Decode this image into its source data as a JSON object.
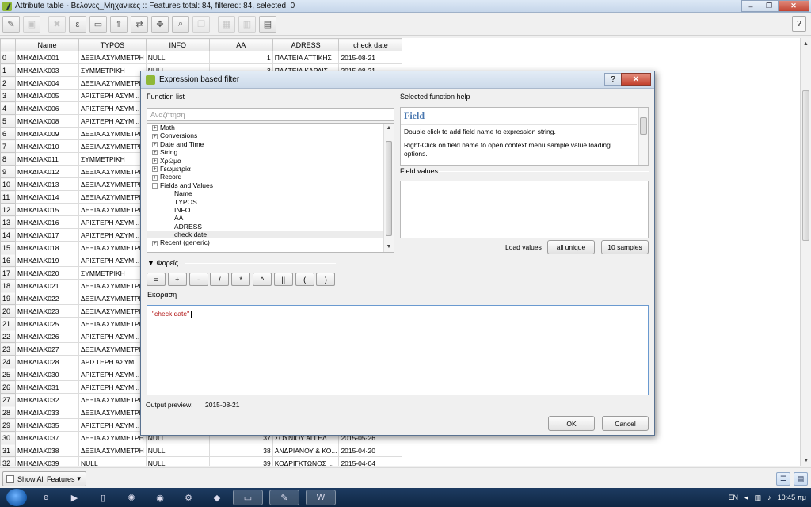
{
  "window": {
    "title": "Attribute table - Βελόνες_Μηχανικές :: Features total: 84, filtered: 84, selected: 0",
    "controls": [
      "–",
      "❐",
      "✕"
    ]
  },
  "toolbar": {
    "help": "?"
  },
  "table": {
    "columns": [
      "Name",
      "TYPOS",
      "INFO",
      "AA",
      "ADRESS",
      "check date"
    ],
    "rows": [
      [
        "0",
        "ΜΗΧΔΙΑΚ001",
        "ΔΕΞΙΑ ΑΣΥΜΜΕΤΡΗ",
        "NULL",
        "1",
        "ΠΛΑΤΕΙΑ ΑΤΤΙΚΗΣ",
        "2015-08-21"
      ],
      [
        "1",
        "ΜΗΧΔΙΑΚ003",
        "ΣΥΜΜΕΤΡΙΚΗ",
        "NULL",
        "3",
        "ΠΛΑΤΕΙΑ ΚΑΡΑΙΣ",
        "2015-08-21"
      ],
      [
        "2",
        "ΜΗΧΔΙΑΚ004",
        "ΔΕΞΙΑ ΑΣΥΜΜΕΤΡΗ",
        "",
        "",
        "",
        ""
      ],
      [
        "3",
        "ΜΗΧΔΙΑΚ005",
        "ΑΡΙΣΤΕΡΗ ΑΣΥΜ...",
        "",
        "",
        "",
        ""
      ],
      [
        "4",
        "ΜΗΧΔΙΑΚ006",
        "ΑΡΙΣΤΕΡΗ ΑΣΥΜ...",
        "",
        "",
        "",
        ""
      ],
      [
        "5",
        "ΜΗΧΔΙΑΚ008",
        "ΑΡΙΣΤΕΡΗ ΑΣΥΜ...",
        "",
        "",
        "",
        ""
      ],
      [
        "6",
        "ΜΗΧΔΙΑΚ009",
        "ΔΕΞΙΑ ΑΣΥΜΜΕΤΡΗ",
        "",
        "",
        "",
        ""
      ],
      [
        "7",
        "ΜΗΧΔΙΑΚ010",
        "ΔΕΞΙΑ ΑΣΥΜΜΕΤΡΗ",
        "",
        "",
        "",
        ""
      ],
      [
        "8",
        "ΜΗΧΔΙΑΚ011",
        "ΣΥΜΜΕΤΡΙΚΗ",
        "",
        "",
        "",
        ""
      ],
      [
        "9",
        "ΜΗΧΔΙΑΚ012",
        "ΔΕΞΙΑ ΑΣΥΜΜΕΤΡΗ",
        "",
        "",
        "",
        ""
      ],
      [
        "10",
        "ΜΗΧΔΙΑΚ013",
        "ΔΕΞΙΑ ΑΣΥΜΜΕΤΡΗ",
        "",
        "",
        "",
        ""
      ],
      [
        "11",
        "ΜΗΧΔΙΑΚ014",
        "ΔΕΞΙΑ ΑΣΥΜΜΕΤΡΗ",
        "",
        "",
        "",
        ""
      ],
      [
        "12",
        "ΜΗΧΔΙΑΚ015",
        "ΔΕΞΙΑ ΑΣΥΜΜΕΤΡΗ",
        "",
        "",
        "",
        ""
      ],
      [
        "13",
        "ΜΗΧΔΙΑΚ016",
        "ΑΡΙΣΤΕΡΗ ΑΣΥΜ...",
        "",
        "",
        "",
        ""
      ],
      [
        "14",
        "ΜΗΧΔΙΑΚ017",
        "ΑΡΙΣΤΕΡΗ ΑΣΥΜ...",
        "",
        "",
        "",
        ""
      ],
      [
        "15",
        "ΜΗΧΔΙΑΚ018",
        "ΔΕΞΙΑ ΑΣΥΜΜΕΤΡΗ",
        "",
        "",
        "",
        ""
      ],
      [
        "16",
        "ΜΗΧΔΙΑΚ019",
        "ΑΡΙΣΤΕΡΗ ΑΣΥΜ...",
        "",
        "",
        "",
        ""
      ],
      [
        "17",
        "ΜΗΧΔΙΑΚ020",
        "ΣΥΜΜΕΤΡΙΚΗ",
        "",
        "",
        "",
        ""
      ],
      [
        "18",
        "ΜΗΧΔΙΑΚ021",
        "ΔΕΞΙΑ ΑΣΥΜΜΕΤΡΗ",
        "",
        "",
        "",
        ""
      ],
      [
        "19",
        "ΜΗΧΔΙΑΚ022",
        "ΔΕΞΙΑ ΑΣΥΜΜΕΤΡΗ",
        "",
        "",
        "",
        ""
      ],
      [
        "20",
        "ΜΗΧΔΙΑΚ023",
        "ΔΕΞΙΑ ΑΣΥΜΜΕΤΡΗ",
        "",
        "",
        "",
        ""
      ],
      [
        "21",
        "ΜΗΧΔΙΑΚ025",
        "ΔΕΞΙΑ ΑΣΥΜΜΕΤΡΗ",
        "",
        "",
        "",
        ""
      ],
      [
        "22",
        "ΜΗΧΔΙΑΚ026",
        "ΑΡΙΣΤΕΡΗ ΑΣΥΜ...",
        "",
        "",
        "",
        ""
      ],
      [
        "23",
        "ΜΗΧΔΙΑΚ027",
        "ΔΕΞΙΑ ΑΣΥΜΜΕΤΡΗ",
        "",
        "",
        "",
        ""
      ],
      [
        "24",
        "ΜΗΧΔΙΑΚ028",
        "ΑΡΙΣΤΕΡΗ ΑΣΥΜ...",
        "",
        "",
        "",
        ""
      ],
      [
        "25",
        "ΜΗΧΔΙΑΚ030",
        "ΑΡΙΣΤΕΡΗ ΑΣΥΜ...",
        "",
        "",
        "",
        ""
      ],
      [
        "26",
        "ΜΗΧΔΙΑΚ031",
        "ΑΡΙΣΤΕΡΗ ΑΣΥΜ...",
        "",
        "",
        "",
        ""
      ],
      [
        "27",
        "ΜΗΧΔΙΑΚ032",
        "ΔΕΞΙΑ ΑΣΥΜΜΕΤΡΗ",
        "",
        "",
        "",
        ""
      ],
      [
        "28",
        "ΜΗΧΔΙΑΚ033",
        "ΔΕΞΙΑ ΑΣΥΜΜΕΤΡΗ",
        "",
        "",
        "",
        ""
      ],
      [
        "29",
        "ΜΗΧΔΙΑΚ035",
        "ΑΡΙΣΤΕΡΗ ΑΣΥΜ...",
        "",
        "",
        "",
        ""
      ],
      [
        "30",
        "ΜΗΧΔΙΑΚ037",
        "ΔΕΞΙΑ ΑΣΥΜΜΕΤΡΗ",
        "NULL",
        "37",
        "ΣΟΥΝΙΟΥ ΑΓΓΕΛ...",
        "2015-05-26"
      ],
      [
        "31",
        "ΜΗΧΔΙΑΚ038",
        "ΔΕΞΙΑ ΑΣΥΜΜΕΤΡΗ",
        "NULL",
        "38",
        "ΑΝΔΡΙΑΝΟΥ & ΚΟ...",
        "2015-04-20"
      ],
      [
        "32",
        "ΜΗΧΔΙΑΚ039",
        "NULL",
        "NULL",
        "39",
        "ΚΟΔΡΙΓΚΤΩΝΟΣ ...",
        "2015-04-04"
      ]
    ]
  },
  "bottom": {
    "show_all": "Show All Features"
  },
  "taskbar": {
    "lang": "EN",
    "time": "10:45 πμ"
  },
  "dialog": {
    "title": "Expression based filter",
    "help_btn": "?",
    "close_btn": "✕",
    "function_list_label": "Function list",
    "search_placeholder": "Αναζήτηση",
    "tree": [
      {
        "label": "Math",
        "box": "+",
        "indent": 0
      },
      {
        "label": "Conversions",
        "box": "+",
        "indent": 0
      },
      {
        "label": "Date and Time",
        "box": "+",
        "indent": 0
      },
      {
        "label": "String",
        "box": "+",
        "indent": 0
      },
      {
        "label": "Χρώμα",
        "box": "+",
        "indent": 0
      },
      {
        "label": "Γεωμετρία",
        "box": "+",
        "indent": 0
      },
      {
        "label": "Record",
        "box": "+",
        "indent": 0
      },
      {
        "label": "Fields and Values",
        "box": "−",
        "indent": 0
      },
      {
        "label": "Name",
        "box": "",
        "indent": 1
      },
      {
        "label": "TYPOS",
        "box": "",
        "indent": 1
      },
      {
        "label": "INFO",
        "box": "",
        "indent": 1
      },
      {
        "label": "AA",
        "box": "",
        "indent": 1
      },
      {
        "label": "ADRESS",
        "box": "",
        "indent": 1
      },
      {
        "label": "check date",
        "box": "",
        "indent": 1,
        "selected": true
      },
      {
        "label": "Recent (generic)",
        "box": "+",
        "indent": 0
      }
    ],
    "help_label": "Selected function help",
    "help_title": "Field",
    "help_text_1": "Double click to add field name to expression string.",
    "help_text_2": "Right-Click on field name to open context menu sample value loading options.",
    "field_values_label": "Field values",
    "load_values_label": "Load values",
    "all_unique": "all unique",
    "ten_samples": "10 samples",
    "operators_label": "▼ Φορείς",
    "operators": [
      "=",
      "+",
      "-",
      "/",
      "*",
      "^",
      "||",
      "(",
      ")"
    ],
    "expression_label": "Έκφραση",
    "expression": "\"check date\"",
    "output_preview_label": "Output preview:",
    "output_preview_value": "2015-08-21",
    "ok": "OK",
    "cancel": "Cancel"
  }
}
